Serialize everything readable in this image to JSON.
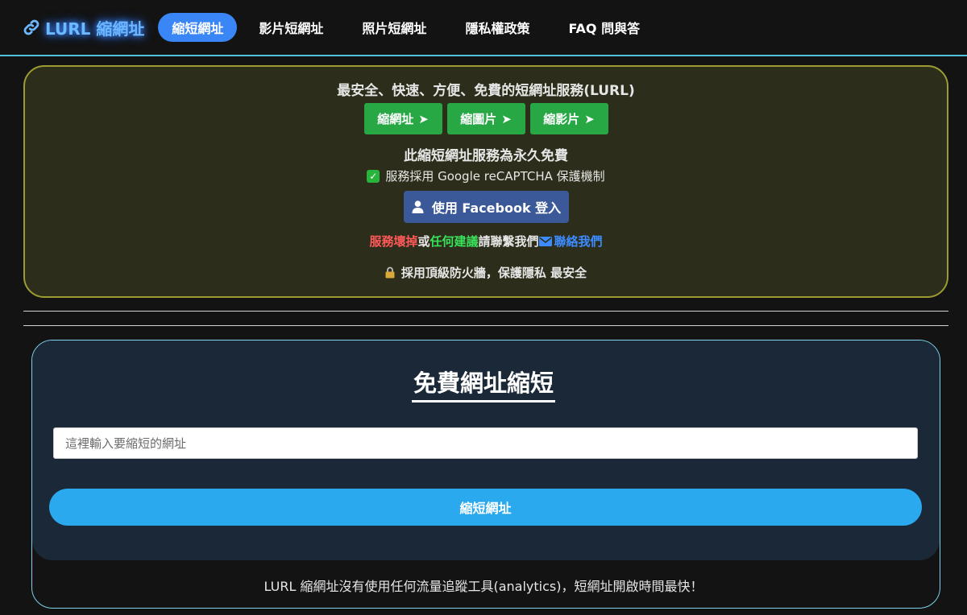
{
  "header": {
    "brand": "LURL 縮網址",
    "nav": [
      {
        "label": "縮短網址",
        "active": true
      },
      {
        "label": "影片短網址",
        "active": false
      },
      {
        "label": "照片短網址",
        "active": false
      },
      {
        "label": "隱私權政策",
        "active": false
      },
      {
        "label": "FAQ 問與答",
        "active": false
      }
    ]
  },
  "info": {
    "headline": "最安全、快速、方便、免費的短網址服務(LURL)",
    "buttons": [
      {
        "label": "縮網址",
        "icon": "arrow-right-icon"
      },
      {
        "label": "縮圖片",
        "icon": "arrow-right-icon"
      },
      {
        "label": "縮影片",
        "icon": "arrow-right-icon"
      }
    ],
    "free_text": "此縮短網址服務為永久免費",
    "recaptcha_text": "服務採用 Google reCAPTCHA 保護機制",
    "facebook_login": "使用 Facebook 登入",
    "contact": {
      "broken": "服務壞掉",
      "or": "或",
      "suggest": "任何建議",
      "please": "請聯繫我們",
      "link": "聯絡我們"
    },
    "secure_text": "採用頂級防火牆，保護隱私 最安全"
  },
  "shortener": {
    "title": "免費網址縮短",
    "input_placeholder": "這裡輸入要縮短的網址",
    "submit_label": "縮短網址",
    "footer_note": "LURL 縮網址沒有使用任何流量追蹤工具(analytics)，短網址開啟時間最快！"
  },
  "colors": {
    "nav_active": "#3a86f6",
    "green_button": "#28a745",
    "facebook": "#3b5998",
    "submit": "#2aa9ee",
    "panel_border": "#9c9c33",
    "card_border": "#7fd3ec"
  }
}
